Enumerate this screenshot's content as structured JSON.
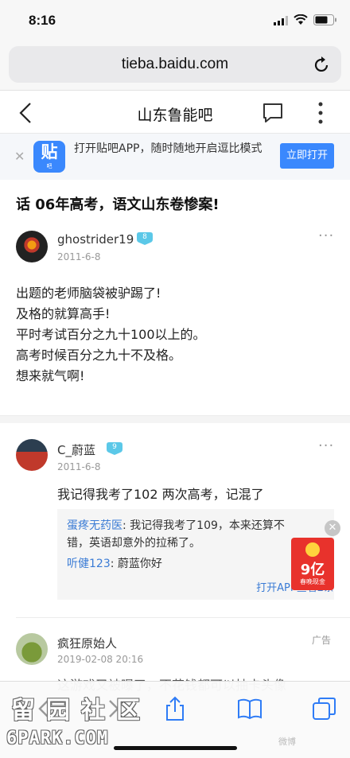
{
  "status": {
    "time": "8:16"
  },
  "browser": {
    "url": "tieba.baidu.com"
  },
  "nav": {
    "title": "山东鲁能吧"
  },
  "banner": {
    "logo_char": "贴",
    "logo_sub": "吧",
    "text": "打开贴吧APP，随时随地开启逗比模式",
    "open_label": "立即打开"
  },
  "thread": {
    "title": "话 06年高考，语文山东卷惨案!"
  },
  "post1": {
    "username": "ghostrider19",
    "level": "8",
    "date": "2011-6-8",
    "more": "···",
    "lines": [
      "出题的老师脑袋被驴踢了!",
      "及格的就算高手!",
      "平时考试百分之九十100以上的。",
      "高考时候百分之九十不及格。",
      "想来就气啊!"
    ]
  },
  "post2": {
    "username": "C_蔚蓝",
    "level": "9",
    "date": "2011-6-8",
    "more": "···",
    "body": "我记得我考了102 两次高考，记混了",
    "replies": [
      {
        "who": "蛋疼无药医",
        "text": ": 我记得我考了109，本来还算不错，英语却意外的拉稀了。"
      },
      {
        "who": "听健123",
        "text": ": 蔚蓝你好"
      }
    ],
    "more_link": "打开APP查看2条"
  },
  "redpacket": {
    "amount": "9亿",
    "caption": "春晚现金"
  },
  "post3": {
    "username": "疯狂原始人",
    "ad_tag": "广告",
    "date": "2019-02-08 20:16",
    "peek": "这游戏又被曝了，不花钱都可以抽卡头像"
  },
  "watermark": {
    "line1": "留园社区",
    "line2": "6PARK.COM",
    "line3": "微博"
  }
}
